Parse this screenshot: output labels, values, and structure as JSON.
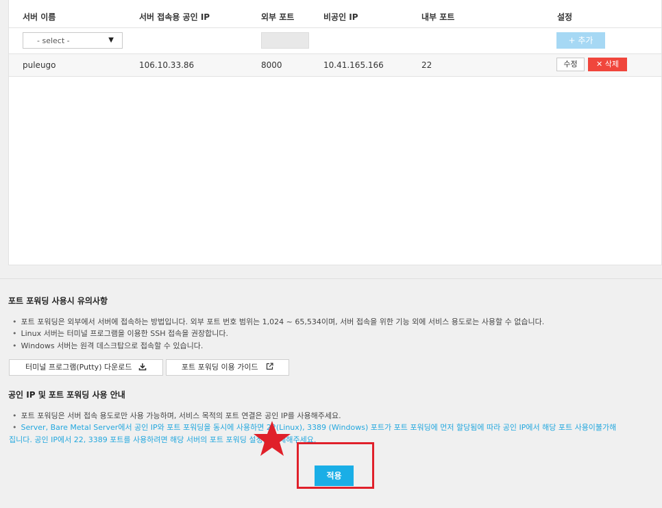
{
  "table": {
    "headers": [
      "서버 이름",
      "서버 접속용 공인 IP",
      "외부 포트",
      "비공인 IP",
      "내부 포트",
      "설정"
    ],
    "select_value": "- select -",
    "add_label": "+ 추가",
    "row": {
      "server": "puleugo",
      "public_ip": "106.10.33.86",
      "external_port": "8000",
      "private_ip": "10.41.165.166",
      "internal_port": "22",
      "edit_label": "수정",
      "delete_label": "✕ 삭제"
    }
  },
  "notice": {
    "title": "포트 포워딩 사용시 유의사항",
    "bullets": [
      "포트 포워딩은 외부에서 서버에 접속하는 방법입니다. 외부 포트 번호 범위는 1,024 ~ 65,534이며, 서버 접속을 위한 기능 외에 서비스 용도로는 사용할 수 없습니다.",
      "Linux 서버는 터미널 프로그램을 이용한 SSH 접속을 권장합니다.",
      "Windows 서버는 원격 데스크탑으로 접속할 수 있습니다."
    ],
    "download_label": "터미널 프로그램(Putty) 다운로드",
    "guide_label": "포트 포워딩 이용 가이드"
  },
  "public_ip_notice": {
    "title": "공인 IP 및 포트 포워딩 사용 안내",
    "bullet1": "포트 포워딩은 서버 접속 용도로만 사용 가능하며, 서비스 목적의 포트 연결은 공인 IP를 사용해주세요.",
    "bullet2_line1": "Server, Bare Metal Server에서 공인 IP와 포트 포워딩을 동시에 사용하면 22(Linux), 3389 (Windows) 포트가 포트 포워딩에 먼저 할당됨에 따라 공인 IP에서 해당 포트 사용이불가해",
    "bullet2_line2": "집니다. 공인 IP에서 22, 3389 포트를 사용하려면 해당 서버의 포트 포워딩 설정을 삭제해주세요."
  },
  "apply_label": "적용",
  "colors": {
    "accent": "#1aaee6",
    "danger": "#f0463c",
    "highlight": "#e0202a"
  }
}
